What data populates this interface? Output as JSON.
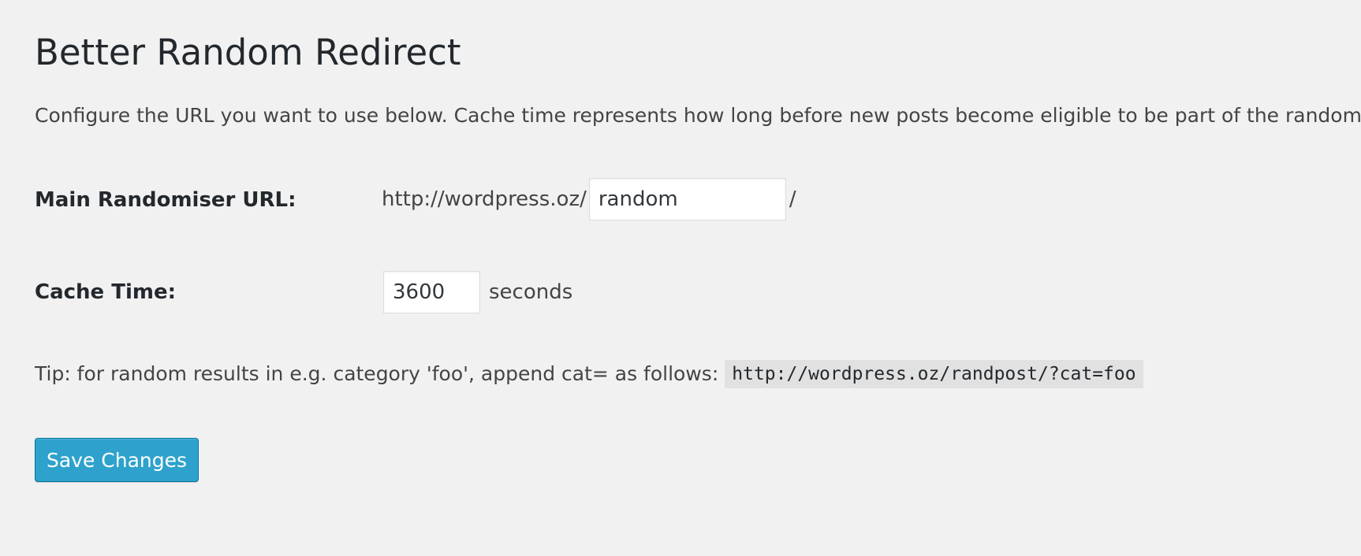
{
  "page": {
    "title": "Better Random Redirect",
    "intro": "Configure the URL you want to use below. Cache time represents how long before new posts become eligible to be part of the randomiser."
  },
  "form": {
    "url_row": {
      "label": "Main Randomiser URL:",
      "prefix": "http://wordpress.oz/",
      "value": "random",
      "suffix": "/"
    },
    "cache_row": {
      "label": "Cache Time:",
      "value": "3600",
      "unit": "seconds"
    },
    "tip": {
      "text": "Tip: for random results in e.g. category 'foo', append cat= as follows:",
      "code": "http://wordpress.oz/randpost/?cat=foo"
    },
    "save_label": "Save Changes"
  },
  "colors": {
    "background": "#f1f1f1",
    "primary_button": "#2ea2cc",
    "code_background": "#e1e1e1"
  }
}
